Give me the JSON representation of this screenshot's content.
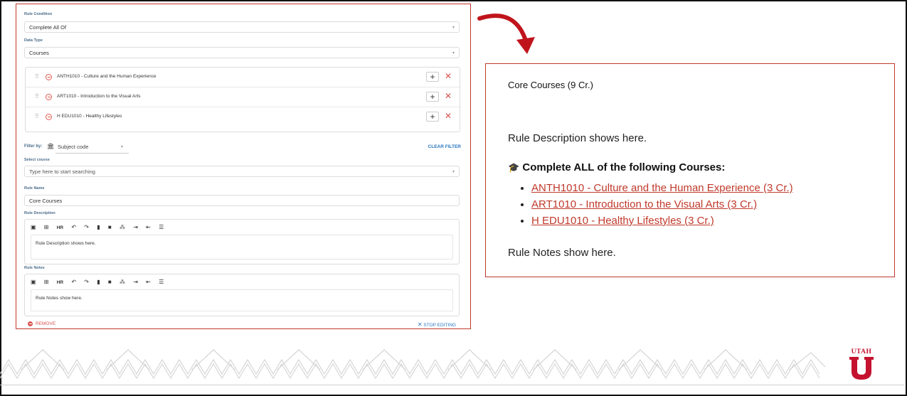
{
  "editor": {
    "rule_condition_label": "Rule Condition",
    "rule_condition_value": "Complete All Of",
    "data_type_label": "Data Type",
    "data_type_value": "Courses",
    "courses": [
      {
        "text": "ANTH1010 - Culture and the Human Experience"
      },
      {
        "text": "ART1010 - Introduction to the Visual Arts"
      },
      {
        "text": "H EDU1010 - Healthy Lifestyles"
      }
    ],
    "filter_label": "Filter by:",
    "filter_value": "Subject code",
    "clear_filter": "CLEAR FILTER",
    "select_course_label": "Select course",
    "select_course_placeholder": "Type here to start searching",
    "rule_name_label": "Rule Name",
    "rule_name_value": "Core Courses",
    "rule_description_label": "Rule Description",
    "rule_description_value": "Rule Description shows here.",
    "rule_notes_label": "Rule Notes",
    "rule_notes_value": "Rule Notes show here.",
    "toolbar_hr": "HR",
    "remove_label": "REMOVE",
    "stop_editing_label": "STOP EDITING"
  },
  "preview": {
    "title": "Core Courses (9 Cr.)",
    "description": "Rule Description shows here.",
    "heading": "Complete ALL of the following Courses:",
    "courses": [
      "ANTH1010 - Culture and the Human Experience (3 Cr.)",
      "ART1010 - Introduction to the Visual Arts (3 Cr.)",
      "H EDU1010 - Healthy Lifestyles (3 Cr.)"
    ],
    "notes": "Rule Notes show here."
  },
  "logo": {
    "word": "UTAH",
    "letter": "U"
  },
  "colors": {
    "accent_red": "#c0392b",
    "link_blue": "#2a78c2",
    "utah_red": "#c4122f"
  },
  "icons": [
    "drag-handle-icon",
    "remove-circle-icon",
    "plus-icon",
    "close-icon",
    "bank-icon",
    "image-icon",
    "table-icon",
    "undo-icon",
    "redo-icon",
    "graduation-cap-icon"
  ]
}
